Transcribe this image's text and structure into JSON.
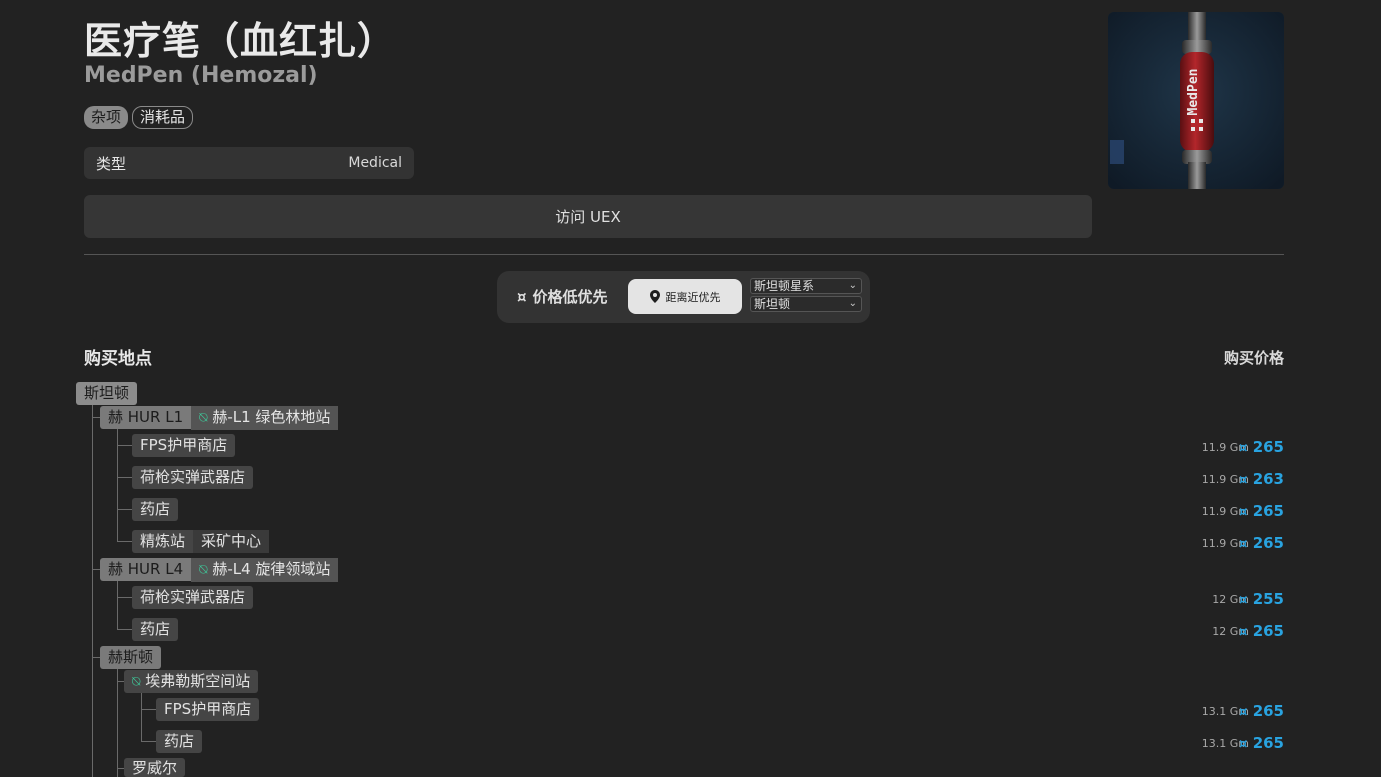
{
  "item": {
    "name_cn": "医疗笔（血红扎）",
    "name_en": "MedPen (Hemozal)",
    "tags": [
      "杂项",
      "消耗品"
    ],
    "type_label": "类型",
    "type_value": "Medical",
    "visit_button": "访问 UEX",
    "image_text": "MedPen"
  },
  "sort": {
    "price_label": "价格低优先",
    "distance_label": "距离近优先",
    "system_select": "斯坦顿星系",
    "location_select": "斯坦顿",
    "price_icon": "currency-icon",
    "distance_icon": "map-pin-icon"
  },
  "columns": {
    "location": "购买地点",
    "price": "购买价格"
  },
  "currency_symbol": "¤",
  "tree": {
    "system": "斯坦顿",
    "hur_l1": {
      "name": "赫 HUR L1",
      "station": "赫-L1 绿色林地站"
    },
    "hur_l4": {
      "name": "赫 HUR L4",
      "station": "赫-L4 旋律领域站"
    },
    "hurston": {
      "name": "赫斯顿",
      "station": "埃弗勒斯空间站"
    },
    "lorville": "罗威尔"
  },
  "rows": [
    {
      "shop": "FPS护甲商店",
      "distance": "11.9 Gm",
      "price": "265"
    },
    {
      "shop": "荷枪实弹武器店",
      "distance": "11.9 Gm",
      "price": "263"
    },
    {
      "shop": "药店",
      "distance": "11.9 Gm",
      "price": "265"
    },
    {
      "shop": "精炼站",
      "sub": "采矿中心",
      "distance": "11.9 Gm",
      "price": "265"
    },
    {
      "shop": "荷枪实弹武器店",
      "distance": "12 Gm",
      "price": "255"
    },
    {
      "shop": "药店",
      "distance": "12 Gm",
      "price": "265"
    },
    {
      "shop": "FPS护甲商店",
      "distance": "13.1 Gm",
      "price": "265"
    },
    {
      "shop": "药店",
      "distance": "13.1 Gm",
      "price": "265"
    }
  ]
}
